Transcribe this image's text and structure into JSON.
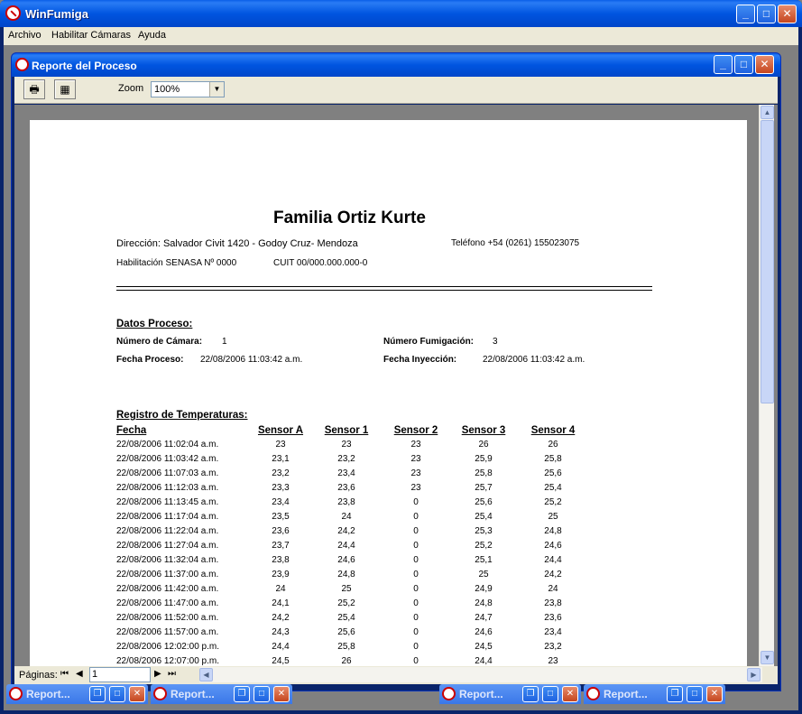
{
  "app": {
    "title": "WinFumiga",
    "menu": [
      "Archivo",
      "Habilitar Cámaras",
      "Ayuda"
    ]
  },
  "child": {
    "title": "Reporte del Proceso",
    "zoom_label": "Zoom",
    "zoom_value": "100%"
  },
  "report": {
    "company": "Familia Ortiz Kurte",
    "address": "Dirección: Salvador Civit 1420 - Godoy Cruz- Mendoza",
    "phone": "Teléfono +54 (0261) 155023075",
    "senasa": "Habilitación SENASA Nº 0000",
    "cuit": "CUIT 00/000.000.000-0",
    "process_heading": "Datos Proceso:",
    "camara_label": "Número de Cámara:",
    "camara_value": "1",
    "fumigacion_label": "Número Fumigación:",
    "fumigacion_value": "3",
    "fecha_proceso_label": "Fecha Proceso:",
    "fecha_proceso_value": "22/08/2006 11:03:42 a.m.",
    "fecha_inyeccion_label": "Fecha Inyección:",
    "fecha_inyeccion_value": "22/08/2006 11:03:42 a.m.",
    "temps_heading": "Registro de Temperaturas:",
    "columns": [
      "Fecha",
      "Sensor A",
      "Sensor 1",
      "Sensor 2",
      "Sensor 3",
      "Sensor 4"
    ],
    "rows": [
      [
        "22/08/2006 11:02:04 a.m.",
        "23",
        "23",
        "23",
        "26",
        "26"
      ],
      [
        "22/08/2006 11:03:42 a.m.",
        "23,1",
        "23,2",
        "23",
        "25,9",
        "25,8"
      ],
      [
        "22/08/2006 11:07:03 a.m.",
        "23,2",
        "23,4",
        "23",
        "25,8",
        "25,6"
      ],
      [
        "22/08/2006 11:12:03 a.m.",
        "23,3",
        "23,6",
        "23",
        "25,7",
        "25,4"
      ],
      [
        "22/08/2006 11:13:45 a.m.",
        "23,4",
        "23,8",
        "0",
        "25,6",
        "25,2"
      ],
      [
        "22/08/2006 11:17:04 a.m.",
        "23,5",
        "24",
        "0",
        "25,4",
        "25"
      ],
      [
        "22/08/2006 11:22:04 a.m.",
        "23,6",
        "24,2",
        "0",
        "25,3",
        "24,8"
      ],
      [
        "22/08/2006 11:27:04 a.m.",
        "23,7",
        "24,4",
        "0",
        "25,2",
        "24,6"
      ],
      [
        "22/08/2006 11:32:04 a.m.",
        "23,8",
        "24,6",
        "0",
        "25,1",
        "24,4"
      ],
      [
        "22/08/2006 11:37:00 a.m.",
        "23,9",
        "24,8",
        "0",
        "25",
        "24,2"
      ],
      [
        "22/08/2006 11:42:00 a.m.",
        "24",
        "25",
        "0",
        "24,9",
        "24"
      ],
      [
        "22/08/2006 11:47:00 a.m.",
        "24,1",
        "25,2",
        "0",
        "24,8",
        "23,8"
      ],
      [
        "22/08/2006 11:52:00 a.m.",
        "24,2",
        "25,4",
        "0",
        "24,7",
        "23,6"
      ],
      [
        "22/08/2006 11:57:00 a.m.",
        "24,3",
        "25,6",
        "0",
        "24,6",
        "23,4"
      ],
      [
        "22/08/2006 12:02:00 p.m.",
        "24,4",
        "25,8",
        "0",
        "24,5",
        "23,2"
      ],
      [
        "22/08/2006 12:07:00 p.m.",
        "24,5",
        "26",
        "0",
        "24,4",
        "23"
      ]
    ]
  },
  "status": {
    "pages_label": "Páginas:",
    "page_value": "1"
  },
  "minimized": [
    "Report...",
    "Report...",
    "Report...",
    "Report..."
  ]
}
